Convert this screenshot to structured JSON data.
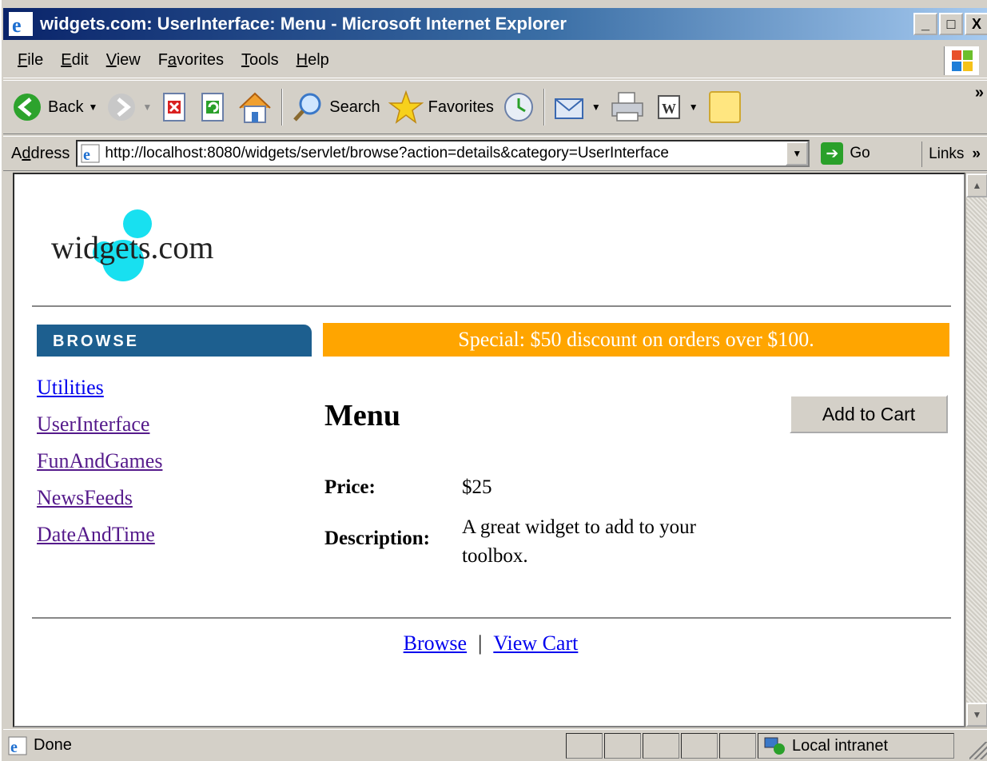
{
  "window": {
    "title": "widgets.com: UserInterface: Menu - Microsoft Internet Explorer",
    "controls": {
      "minimize": "_",
      "maximize": "□",
      "close": "X"
    }
  },
  "menubar": {
    "items": [
      {
        "prefix": "",
        "accel": "F",
        "rest": "ile"
      },
      {
        "prefix": "",
        "accel": "E",
        "rest": "dit"
      },
      {
        "prefix": "",
        "accel": "V",
        "rest": "iew"
      },
      {
        "prefix": "F",
        "accel": "a",
        "rest": "vorites"
      },
      {
        "prefix": "",
        "accel": "T",
        "rest": "ools"
      },
      {
        "prefix": "",
        "accel": "H",
        "rest": "elp"
      }
    ]
  },
  "toolbar": {
    "back_label": "Back",
    "search_label": "Search",
    "favorites_label": "Favorites",
    "more": "»"
  },
  "addressbar": {
    "label_prefix": "A",
    "label_accel": "d",
    "label_rest": "dress",
    "url": "http://localhost:8080/widgets/servlet/browse?action=details&category=UserInterface",
    "go_label": "Go",
    "links_label": "Links",
    "more": "»"
  },
  "page": {
    "logo_text": "widgets.com",
    "browse_header": "BROWSE",
    "categories": [
      "Utilities",
      "UserInterface",
      "FunAndGames",
      "NewsFeeds",
      "DateAndTime"
    ],
    "special": "Special: $50 discount on orders over $100.",
    "product": {
      "title": "Menu",
      "add_to_cart": "Add to Cart",
      "price_label": "Price:",
      "price": "$25",
      "description_label": "Description:",
      "description_line1": "A great widget to add to your",
      "description_line2": "toolbox."
    },
    "footer": {
      "browse": "Browse",
      "separator": "|",
      "view_cart": "View Cart"
    }
  },
  "statusbar": {
    "status": "Done",
    "zone": "Local intranet"
  },
  "colors": {
    "browse_header": "#1d5f8f",
    "special_bar": "#ffa500",
    "logo_dot": "#18e0f0",
    "visited_link": "#551a8b",
    "link": "#0000ee"
  }
}
